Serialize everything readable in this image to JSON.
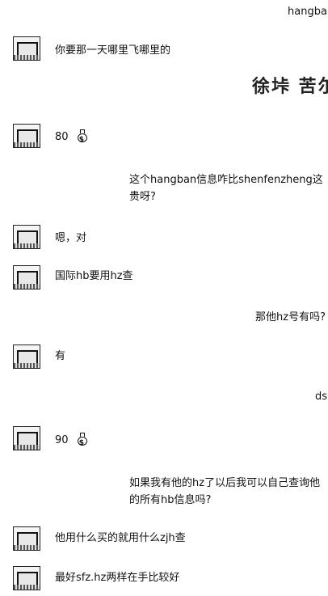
{
  "messages": [
    {
      "text": "hangba",
      "side": "right"
    },
    {
      "text": "你要那一天哪里飞哪里的",
      "side": "left"
    },
    {
      "text": "徐垰 苦尔",
      "side": "right",
      "style": "big"
    },
    {
      "text": "80",
      "side": "left",
      "icon": "money-bag-icon"
    },
    {
      "text": "这个hangban信息咋比shenfenzheng这",
      "side": "right"
    },
    {
      "text": "贵呀?",
      "side": "right"
    },
    {
      "text": "嗯，对",
      "side": "left"
    },
    {
      "text": "国际hb要用hz查",
      "side": "left"
    },
    {
      "text": "那他hz号有吗?",
      "side": "right"
    },
    {
      "text": "有",
      "side": "left"
    },
    {
      "text": "ds",
      "side": "right"
    },
    {
      "text": "90",
      "side": "left",
      "icon": "money-bag-icon"
    },
    {
      "text": "如果我有他的hz了以后我可以自己查询他",
      "side": "right"
    },
    {
      "text": "的所有hb信息吗?",
      "side": "right"
    },
    {
      "text": "他用什么买的就用什么zjh查",
      "side": "left"
    },
    {
      "text": "最好sfz.hz两样在手比较好",
      "side": "left"
    }
  ]
}
